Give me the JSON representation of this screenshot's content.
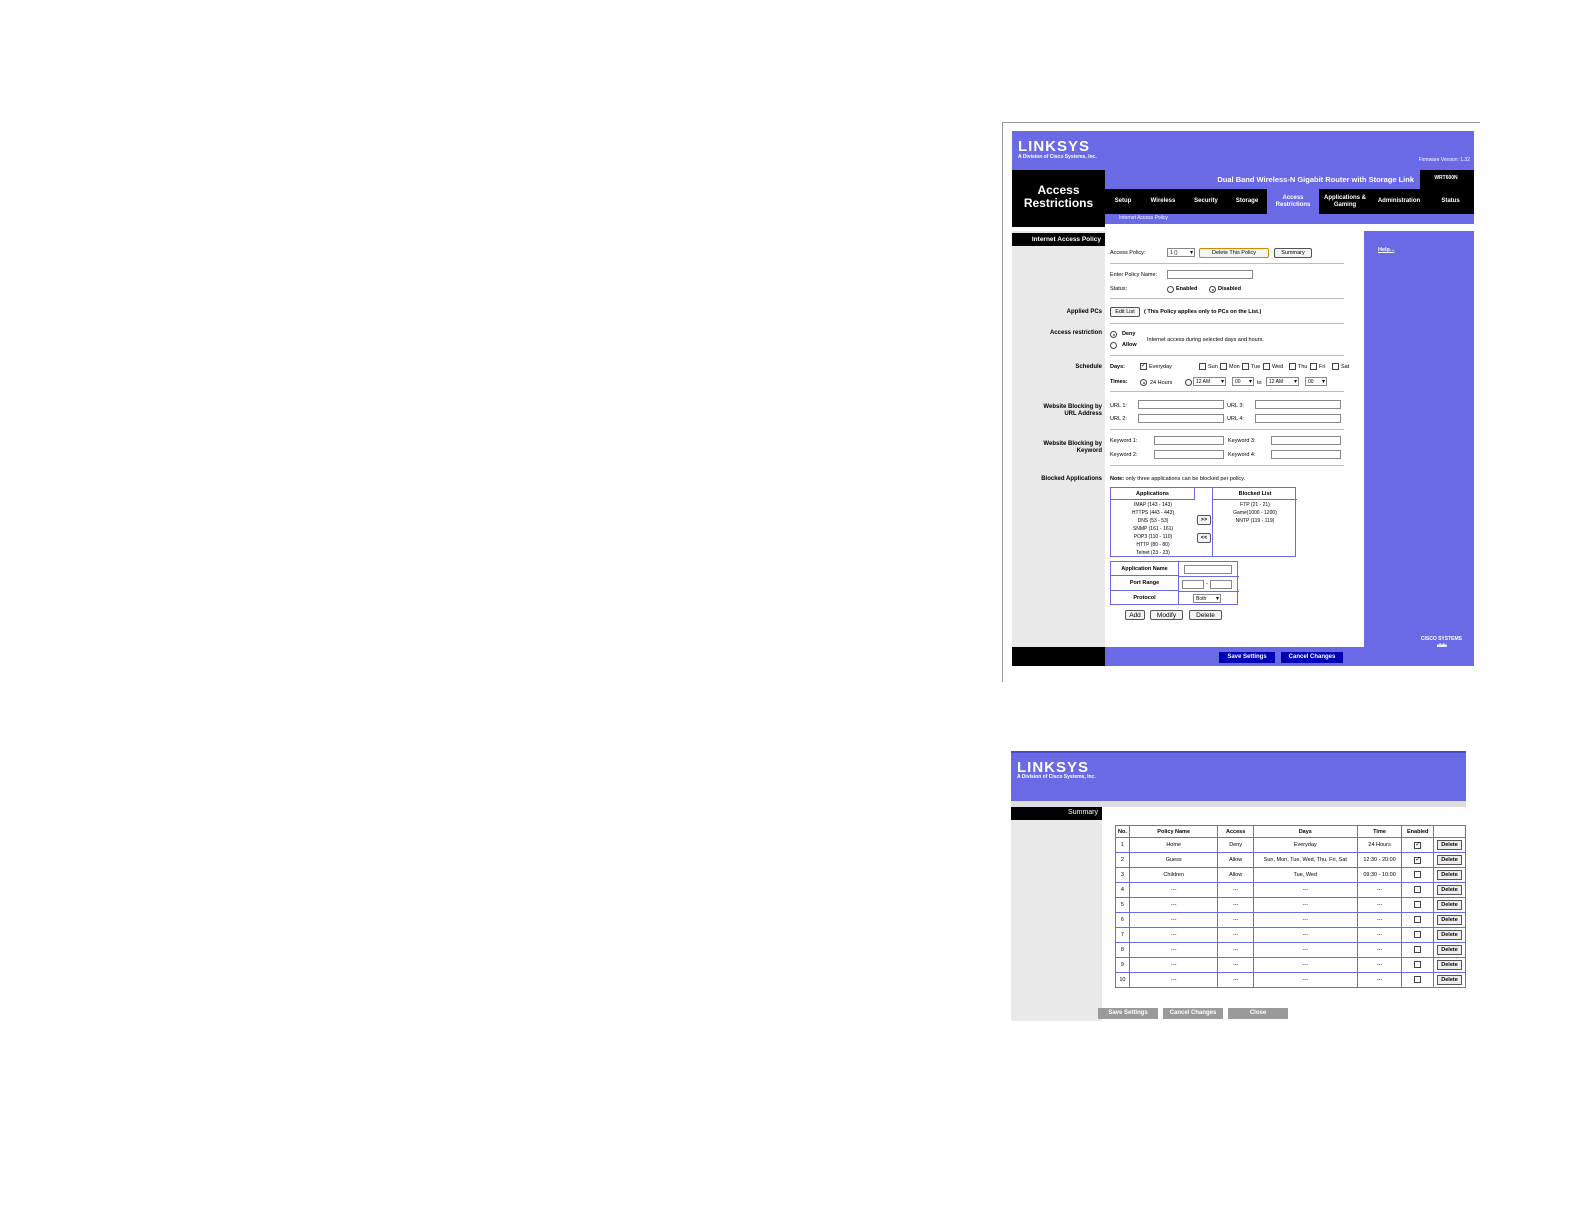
{
  "screen1": {
    "logo": "LINKSYS",
    "logo_sub": "A Division of Cisco Systems, Inc.",
    "firmware": "Firmware Version: 1.32",
    "product": "Dual Band Wireless-N Gigabit Router with Storage Link",
    "model": "WRT600N",
    "section": "Access Restrictions",
    "tabs": [
      "Setup",
      "Wireless",
      "Security",
      "Storage",
      "Access Restrictions",
      "Applications & Gaming",
      "Administration",
      "Status"
    ],
    "subtab": "Internet Access Policy",
    "left_header": "Internet Access Policy",
    "labels": {
      "applied_pcs": "Applied PCs",
      "access_restriction": "Access restriction",
      "schedule": "Schedule",
      "url_blocking": "Website Blocking by URL Address",
      "keyword_blocking": "Website Blocking by Keyword",
      "blocked_apps": "Blocked Applications"
    },
    "access_policy_label": "Access Policy:",
    "access_policy_value": "1 ()",
    "delete_policy_btn": "Delete This Policy",
    "summary_btn": "Summary",
    "policy_name_label": "Enter Policy Name:",
    "status_label": "Status:",
    "enabled": "Enabled",
    "disabled": "Disabled",
    "edit_list_btn": "Edit List",
    "edit_list_note": "( This Policy applies only to PCs on the List.)",
    "deny": "Deny",
    "allow": "Allow",
    "access_note": "Internet access during selected days and hours.",
    "days_label": "Days:",
    "days": [
      "Everyday",
      "Sun",
      "Mon",
      "Tue",
      "Wed",
      "Thu",
      "Fri",
      "Sat"
    ],
    "times_label": "Times:",
    "hours24": "24 Hours",
    "time_from_h": "12 AM",
    "time_from_m": "00",
    "to": "to",
    "time_to_h": "12 AM",
    "time_to_m": "00",
    "url1": "URL 1:",
    "url2": "URL 2:",
    "url3": "URL 3:",
    "url4": "URL 4:",
    "kw1": "Keyword 1:",
    "kw2": "Keyword 2:",
    "kw3": "Keyword 3:",
    "kw4": "Keyword 4:",
    "apps_note_bold": "Note:",
    "apps_note": " only three applications can be blocked per policy.",
    "applications_header": "Applications",
    "blocked_header": "Blocked List",
    "applications": [
      "IMAP (143 - 143)",
      "HTTPS (443 - 443)",
      "DNS (53 - 53)",
      "SNMP (161 - 161)",
      "POP3 (110 - 110)",
      "HTTP (80 - 80)",
      "Telnet (23 - 23)"
    ],
    "blocked": [
      "FTP (21 - 21)",
      "Game(1000 - 1200)",
      "NNTP (119 - 119)"
    ],
    "move_right": ">>",
    "move_left": "<<",
    "app_name_label": "Application Name",
    "port_range_label": "Port Range",
    "port_dash": "-",
    "protocol_label": "Protocol",
    "protocol_value": "Both",
    "add_btn": "Add",
    "modify_btn": "Modify",
    "delete_btn": "Delete",
    "help": "Help...",
    "cisco": "CISCO SYSTEMS",
    "save_btn": "Save Settings",
    "cancel_btn": "Cancel Changes"
  },
  "screen2": {
    "logo": "LINKSYS",
    "logo_sub": "A Division of Cisco Systems, Inc.",
    "header": "Summary",
    "columns": [
      "No.",
      "Policy Name",
      "Access",
      "Days",
      "Time",
      "Enabled",
      ""
    ],
    "rows": [
      {
        "no": "1",
        "name": "Home",
        "access": "Deny",
        "days": "Everyday",
        "time": "24 Hours",
        "enabled": true
      },
      {
        "no": "2",
        "name": "Guess",
        "access": "Allow",
        "days": "Sun, Mon, Tue, Wed, Thu, Fri, Sat",
        "time": "12:30 - 20:00",
        "enabled": true
      },
      {
        "no": "3",
        "name": "Children",
        "access": "Allow",
        "days": "Tue, Wed",
        "time": "09:30 - 10:00",
        "enabled": false
      },
      {
        "no": "4",
        "name": "---",
        "access": "---",
        "days": "---",
        "time": "---",
        "enabled": false
      },
      {
        "no": "5",
        "name": "---",
        "access": "---",
        "days": "---",
        "time": "---",
        "enabled": false
      },
      {
        "no": "6",
        "name": "---",
        "access": "---",
        "days": "---",
        "time": "---",
        "enabled": false
      },
      {
        "no": "7",
        "name": "---",
        "access": "---",
        "days": "---",
        "time": "---",
        "enabled": false
      },
      {
        "no": "8",
        "name": "---",
        "access": "---",
        "days": "---",
        "time": "---",
        "enabled": false
      },
      {
        "no": "9",
        "name": "---",
        "access": "---",
        "days": "---",
        "time": "---",
        "enabled": false
      },
      {
        "no": "10",
        "name": "---",
        "access": "---",
        "days": "---",
        "time": "---",
        "enabled": false
      }
    ],
    "delete_label": "Delete",
    "save_btn": "Save Settings",
    "cancel_btn": "Cancel Changes",
    "close_btn": "Close"
  },
  "colors": {
    "accent": "#6a6ae6",
    "dark": "#000000",
    "panel": "#e9e9e9",
    "button_blue": "#0000b4"
  }
}
